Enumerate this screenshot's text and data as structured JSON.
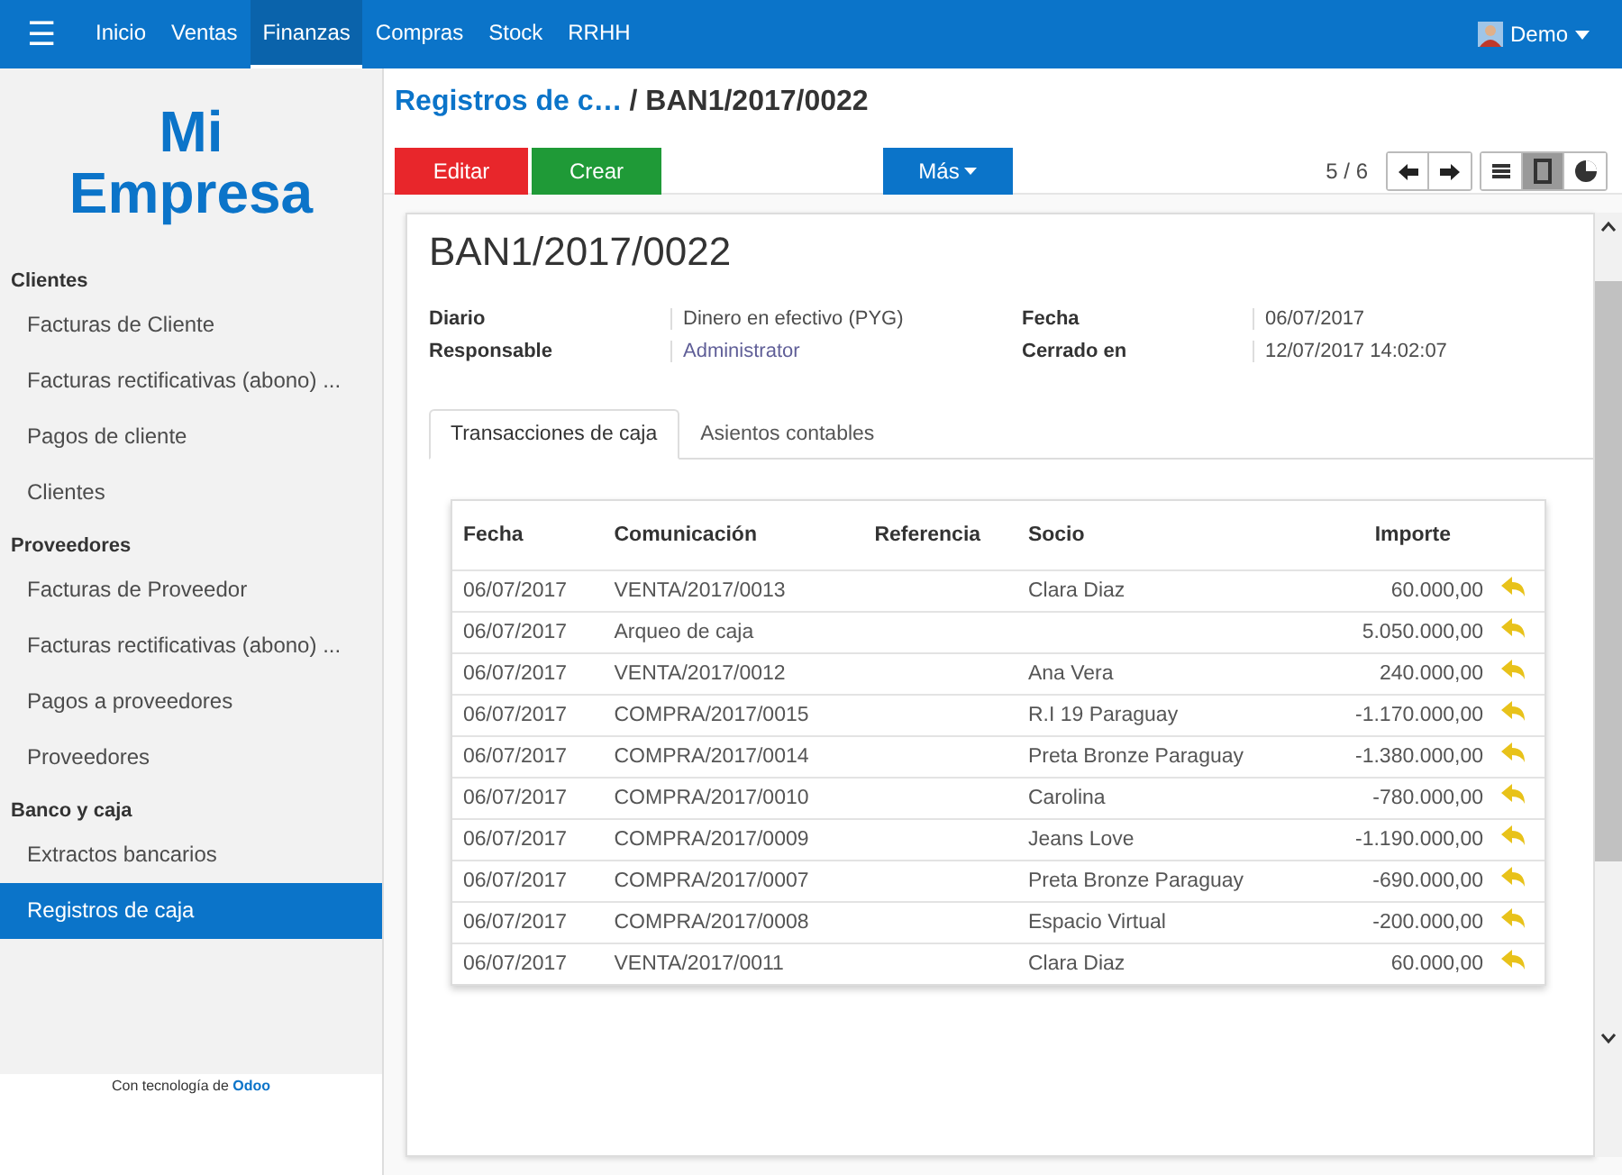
{
  "topbar": {
    "menu_icon": "☰",
    "apps": [
      {
        "label": "Inicio",
        "selected": false
      },
      {
        "label": "Ventas",
        "selected": false
      },
      {
        "label": "Finanzas",
        "selected": true
      },
      {
        "label": "Compras",
        "selected": false
      },
      {
        "label": "Stock",
        "selected": false
      },
      {
        "label": "RRHH",
        "selected": false
      }
    ],
    "user": "Demo"
  },
  "sidebar": {
    "logo": [
      "Mi",
      "Empresa"
    ],
    "sections": [
      {
        "title": "Clientes",
        "items": [
          {
            "label": "Facturas de Cliente",
            "selected": false
          },
          {
            "label": "Facturas rectificativas (abono) ...",
            "selected": false
          },
          {
            "label": "Pagos de cliente",
            "selected": false
          },
          {
            "label": "Clientes",
            "selected": false
          }
        ]
      },
      {
        "title": "Proveedores",
        "items": [
          {
            "label": "Facturas de Proveedor",
            "selected": false
          },
          {
            "label": "Facturas rectificativas (abono) ...",
            "selected": false
          },
          {
            "label": "Pagos a proveedores",
            "selected": false
          },
          {
            "label": "Proveedores",
            "selected": false
          }
        ]
      },
      {
        "title": "Banco y caja",
        "items": [
          {
            "label": "Extractos bancarios",
            "selected": false
          },
          {
            "label": "Registros de caja",
            "selected": true
          }
        ]
      }
    ],
    "footer": "Con tecnología de **Odoo**"
  },
  "breadcrumb": {
    "parent": "Registros de c…",
    "current": "/ BAN1/2017/0022"
  },
  "buttons": {
    "edit": "Editar",
    "create": "Crear",
    "more": "Más"
  },
  "pager": "5 / 6",
  "views": [
    {
      "kind": "list",
      "selected": false
    },
    {
      "kind": "form",
      "selected": true
    },
    {
      "kind": "chart",
      "selected": false
    }
  ],
  "record": {
    "title": "BAN1/2017/0022",
    "fields": [
      {
        "label": "Diario",
        "value": "Dinero en efectivo (PYG)",
        "kind": "text"
      },
      {
        "label": "Fecha",
        "value": "06/07/2017",
        "kind": "text"
      },
      {
        "label": "Responsable",
        "value": "Administrator",
        "kind": "link"
      },
      {
        "label": "Cerrado en",
        "value": "12/07/2017 14:02:07",
        "kind": "text"
      }
    ],
    "tabs": [
      {
        "label": "Transacciones de caja",
        "selected": true
      },
      {
        "label": "Asientos contables",
        "selected": false
      }
    ],
    "table": {
      "columns": [
        "Fecha",
        "Comunicación",
        "Referencia",
        "Socio",
        "Importe"
      ],
      "rows": [
        [
          "06/07/2017",
          "VENTA/2017/0013",
          "",
          "Clara Diaz",
          "60.000,00"
        ],
        [
          "06/07/2017",
          "Arqueo de caja",
          "",
          "",
          "5.050.000,00"
        ],
        [
          "06/07/2017",
          "VENTA/2017/0012",
          "",
          "Ana Vera",
          "240.000,00"
        ],
        [
          "06/07/2017",
          "COMPRA/2017/0015",
          "",
          "R.I 19 Paraguay",
          "-1.170.000,00"
        ],
        [
          "06/07/2017",
          "COMPRA/2017/0014",
          "",
          "Preta Bronze Paraguay",
          "-1.380.000,00"
        ],
        [
          "06/07/2017",
          "COMPRA/2017/0010",
          "",
          "Carolina",
          "-780.000,00"
        ],
        [
          "06/07/2017",
          "COMPRA/2017/0009",
          "",
          "Jeans Love",
          "-1.190.000,00"
        ],
        [
          "06/07/2017",
          "COMPRA/2017/0007",
          "",
          "Preta Bronze Paraguay",
          "-690.000,00"
        ],
        [
          "06/07/2017",
          "COMPRA/2017/0008",
          "",
          "Espacio Virtual",
          "-200.000,00"
        ],
        [
          "06/07/2017",
          "VENTA/2017/0011",
          "",
          "Clara Diaz",
          "60.000,00"
        ]
      ]
    }
  }
}
